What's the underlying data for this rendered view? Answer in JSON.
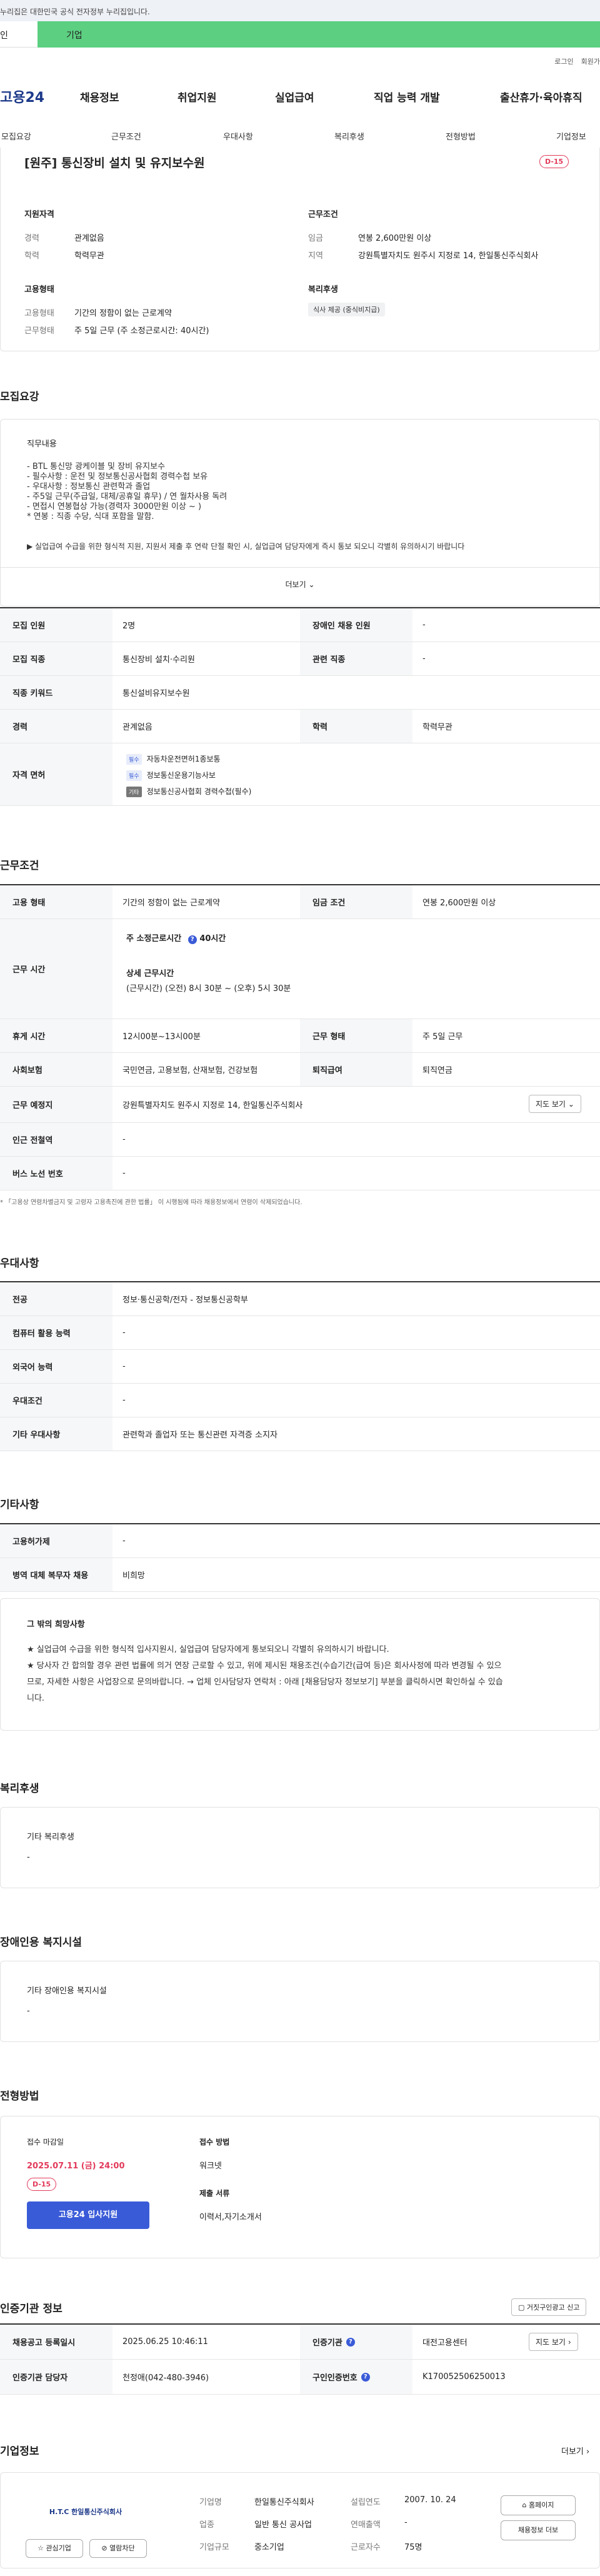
{
  "gov_banner": "누리집은 대한민국 공식 전자정부 누리집입니다.",
  "tabs": {
    "personal": "인",
    "company": "기업"
  },
  "util": {
    "login": "로그인",
    "join": "회원가"
  },
  "logo": "고용24",
  "gnb": [
    "채용정보",
    "취업지원",
    "실업급여",
    "직업 능력 개발",
    "출산휴가·육아휴직"
  ],
  "subnav": [
    "모집요강",
    "근무조건",
    "우대사항",
    "복리후생",
    "전형방법",
    "기업정보"
  ],
  "summary": {
    "title": "[원주] 통신장비 설치 및 유지보수원",
    "dday": "D-15",
    "qual_title": "지원자격",
    "career_k": "경력",
    "career_v": "관계없음",
    "edu_k": "학력",
    "edu_v": "학력무관",
    "cond_title": "근무조건",
    "wage_k": "임금",
    "wage_v": "연봉 2,600만원 이상",
    "area_k": "지역",
    "area_v": "강원특별자치도 원주시 지정로 14, 한일통신주식회사",
    "emp_title": "고용형태",
    "emptype_k": "고용형태",
    "emptype_v": "기간의 정함이 없는 근로계약",
    "worktype_k": "근무형태",
    "worktype_v": "주 5일 근무 (주 소정근로시간: 40시간)",
    "welfare_title": "복리후생",
    "welfare_chip": "식사 제공 (중식비지급)"
  },
  "recruit": {
    "section": "모집요강",
    "desc_title": "직무내용",
    "desc_lines": [
      "- BTL 통신망 광케이블 및 장비 유지보수",
      "- 필수사항 : 운전 및 정보통신공사협회 경력수첩 보유",
      "- 우대사항 : 정보통신 관련학과 졸업",
      "- 주5일 근무(주급일, 대체/공휴일 휴무) /  연 월차사용 독려",
      "- 면접시 연봉협상 가능(경력자 3000만원 이상 ~ )",
      "  * 연봉 : 직종 수당, 식대 포함을 말함."
    ],
    "notice": "▶ 실업급여 수급을 위한 형식적 지원, 지원서 제출 후 연락 단절 확인 시, 실업급여 담당자에게 즉시 통보 되오니 각별히 유의하시기 바랍니다",
    "more": "더보기",
    "rows": {
      "count_k": "모집 인원",
      "count_v": "2명",
      "disabled_k": "장애인 채용 인원",
      "disabled_v": "-",
      "job_k": "모집 직종",
      "job_v": "통신장비 설치·수리원",
      "related_k": "관련 직종",
      "related_v": "-",
      "keyword_k": "직종 키워드",
      "keyword_v": "통신설비유지보수원",
      "career_k": "경력",
      "career_v": "관계없음",
      "edu_k": "학력",
      "edu_v": "학력무관",
      "license_k": "자격 면허",
      "license": [
        {
          "badge": "필수",
          "text": "자동차운전면허1종보통"
        },
        {
          "badge": "필수",
          "text": "정보통신운용기능사보"
        },
        {
          "badge": "기타",
          "text": "정보통신공사협회 경력수첩(필수)"
        }
      ]
    }
  },
  "work": {
    "section": "근무조건",
    "emp_k": "고용 형태",
    "emp_v": "기간의 정함이 없는 근로계약",
    "wage_k": "임금 조건",
    "wage_v": "연봉 2,600만원 이상",
    "hours_k": "근무 시간",
    "hours_label": "주 소정근로시간",
    "hours_v": "40시간",
    "detail_label": "상세 근무시간",
    "detail_v": "(근무시간) (오전) 8시 30분 ~ (오후) 5시 30분",
    "break_k": "휴게 시간",
    "break_v": "12시00분~13시00분",
    "form_k": "근무 형태",
    "form_v": "주 5일 근무",
    "insurance_k": "사회보험",
    "insurance_v": "국민연금, 고용보험, 산재보험, 건강보험",
    "retire_k": "퇴직급여",
    "retire_v": "퇴직연금",
    "place_k": "근무 예정지",
    "place_v": "강원특별자치도 원주시 지정로 14, 한일통신주식회사",
    "map_btn": "지도 보기",
    "station_k": "인근 전철역",
    "station_v": "-",
    "bus_k": "버스 노선 번호",
    "bus_v": "-",
    "footnote": "* 「고용상 연령차별금지 및 고령자 고용촉진에 관한 법률」 이 시행됨에 따라 채용정보에서 연령이 삭제되었습니다."
  },
  "pref": {
    "section": "우대사항",
    "major_k": "전공",
    "major_v": "정보·통신공학/전자 - 정보통신공학부",
    "pc_k": "컴퓨터 활용 능력",
    "pc_v": "-",
    "lang_k": "외국어 능력",
    "lang_v": "-",
    "cond_k": "우대조건",
    "cond_v": "-",
    "etc_k": "기타 우대사항",
    "etc_v": "관련학과 졸업자 또는 통신관련 자격증 소지자"
  },
  "etc": {
    "section": "기타사항",
    "welfare_k": "고용허가제",
    "welfare_v": "-",
    "military_k": "병역 대체 복무자 채용",
    "military_v": "비희망"
  },
  "wish": {
    "title": "그 밖의 희망사항",
    "lines": [
      "★ 실업급여 수급을 위한 형식적 입사지원시, 실업급여 담당자에게 통보되오니 각별히 유의하시기 바랍니다.",
      "★ 당사자 간 합의할 경우 관련 법률에 의거 연장 근로할 수 있고, 위에 제시된 채용조건(수습기간(급여 등)은 회사사정에 따라 변경될 수 있으",
      "므로, 자세한 사항은 사업장으로 문의바랍니다. → 업체 인사담당자 연락처 : 아래 [채용담당자 정보보기] 부분을 클릭하시면 확인하실 수 있습",
      "니다."
    ]
  },
  "benefit": {
    "section": "복리후생",
    "label": "기타 복리후생",
    "value": "-"
  },
  "disab": {
    "section": "장애인용 복지시설",
    "label": "기타 장애인용 복지시설",
    "value": "-"
  },
  "process": {
    "section": "전형방법",
    "deadline_label": "접수 마감일",
    "deadline": "2025.07.11 (금) 24:00",
    "dday": "D-15",
    "apply_btn": "고용24 입사지원",
    "method_label": "접수 방법",
    "method_v": "워크넷",
    "docs_label": "제출 서류",
    "docs_v": "이력서,자기소개서"
  },
  "agency": {
    "section": "인증기관 정보",
    "report_btn": "거짓구인광고 신고",
    "reg_k": "채용공고 등록일시",
    "reg_v": "2025.06.25 10:46:11",
    "org_k": "인증기관",
    "org_v": "대전고용센터",
    "map_btn": "지도 보기",
    "mgr_k": "인증기관 담당자",
    "mgr_v": "천정애(042-480-3946)",
    "no_k": "구인인증번호",
    "no_v": "K170052506250013"
  },
  "company": {
    "section": "기업정보",
    "more": "더보기",
    "logo_text": "H.T.C 한일통신주식회사",
    "name_k": "기업명",
    "name_v": "한일통신주식회사",
    "found_k": "설립연도",
    "found_v": "2007. 10. 24",
    "biz_k": "업종",
    "biz_v": "일반 통신 공사업",
    "sales_k": "연매출액",
    "sales_v": "-",
    "size_k": "기업규모",
    "size_v": "중소기업",
    "staff_k": "근로자수",
    "staff_v": "75명",
    "home_btn": "홈페이지",
    "info_btn": "채용정보 더보",
    "interest_btn": "관심기업",
    "block_btn": "열람차단"
  }
}
